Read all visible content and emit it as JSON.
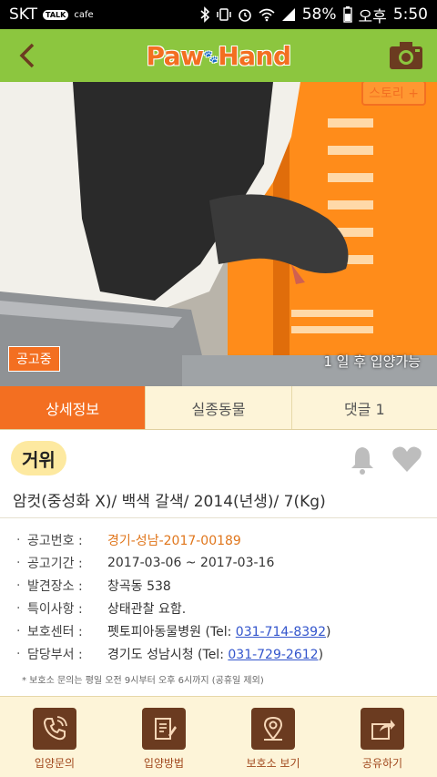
{
  "status_bar": {
    "carrier": "SKT",
    "talk_badge": "TALK",
    "cafe": "cafe",
    "battery": "58%",
    "ampm": "오후",
    "time": "5:50"
  },
  "app_bar": {
    "logo_part1": "Paw",
    "logo_part2": "Hand"
  },
  "hero": {
    "story_button": "스토리 +",
    "notice_badge": "공고중",
    "adopt_text": "1 일 후 입양가능"
  },
  "tabs": [
    {
      "label": "상세정보",
      "active": true
    },
    {
      "label": "실종동물",
      "active": false
    },
    {
      "label": "댓글 1",
      "active": false
    }
  ],
  "animal": {
    "name": "거위",
    "summary": "암컷(중성화 X)/ 백색 갈색/ 2014(년생)/ 7(Kg)"
  },
  "details": [
    {
      "label": "공고번호 :",
      "value": "경기-성남-2017-00189"
    },
    {
      "label": "공고기간 :",
      "value": "2017-03-06 ~ 2017-03-16"
    },
    {
      "label": "발견장소 :",
      "value": "창곡동 538"
    },
    {
      "label": "특이사항 :",
      "value": "상태관찰 요함."
    },
    {
      "label": "보호센터 :",
      "value": "펫토피아동물병원 (Tel: ",
      "tel": "031-714-8392",
      "suffix": ")"
    },
    {
      "label": "담당부서 :",
      "value": "경기도 성남시청 (Tel: ",
      "tel": "031-729-2612",
      "suffix": ")"
    }
  ],
  "footnote": "* 보호소 문의는 평일 오전 9시부터 오후 6시까지 (공휴일 제외)",
  "bottom_nav": [
    {
      "label": "입양문의",
      "icon": "phone-icon"
    },
    {
      "label": "입양방법",
      "icon": "document-icon"
    },
    {
      "label": "보호소 보기",
      "icon": "location-pin-icon"
    },
    {
      "label": "공유하기",
      "icon": "share-icon"
    }
  ],
  "colors": {
    "brand_green": "#8cc63f",
    "accent_orange": "#f36f21",
    "tab_bg": "#fdf4d8",
    "icon_brown": "#6b3b20"
  }
}
